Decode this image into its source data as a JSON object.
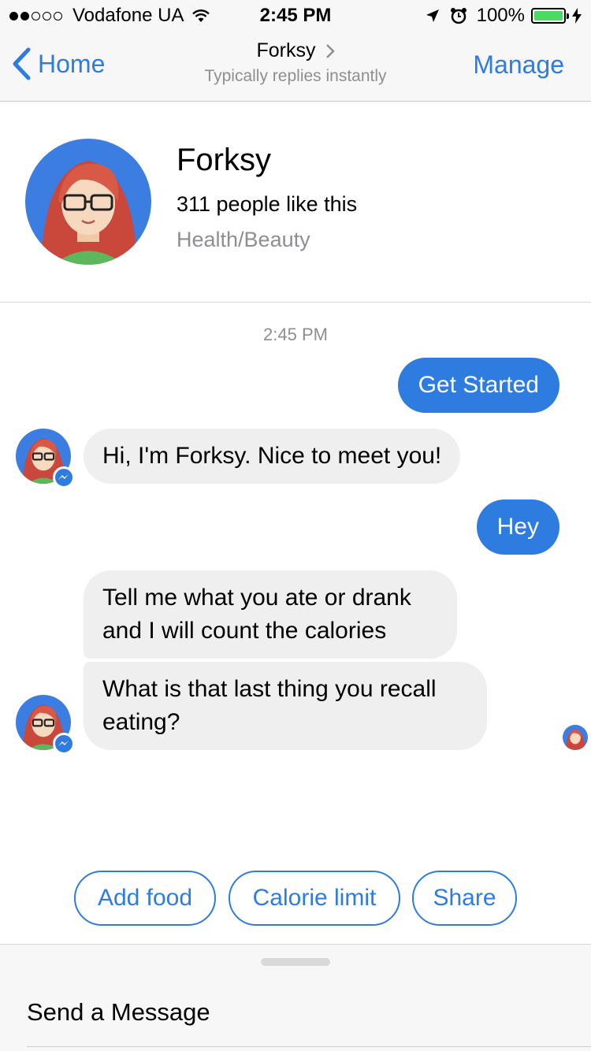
{
  "status_bar": {
    "carrier": "Vodafone UA",
    "time": "2:45 PM",
    "battery": "100%"
  },
  "nav": {
    "back_label": "Home",
    "title": "Forksy",
    "subtitle": "Typically replies instantly",
    "manage_label": "Manage"
  },
  "profile": {
    "name": "Forksy",
    "likes": "311 people like this",
    "category": "Health/Beauty"
  },
  "chat": {
    "timestamp": "2:45 PM",
    "messages": [
      {
        "from": "user",
        "text": "Get Started"
      },
      {
        "from": "bot",
        "text": "Hi, I'm Forksy. Nice to meet you!"
      },
      {
        "from": "user",
        "text": "Hey"
      },
      {
        "from": "bot",
        "text": "Tell me what you ate or drank and I will count the calories"
      },
      {
        "from": "bot",
        "text": "What is that last thing you recall eating?"
      }
    ]
  },
  "quick_replies": [
    "Add food",
    "Calorie limit",
    "Share"
  ],
  "composer": {
    "placeholder": "Send a Message"
  },
  "colors": {
    "accent": "#2e7ce0",
    "bubble_in": "#efefef",
    "battery": "#4cd964"
  },
  "icons": [
    "signal-icon",
    "wifi-icon",
    "location-icon",
    "alarm-icon",
    "battery-icon",
    "charging-icon",
    "back-chevron-icon",
    "title-chevron-icon",
    "messenger-badge-icon"
  ]
}
